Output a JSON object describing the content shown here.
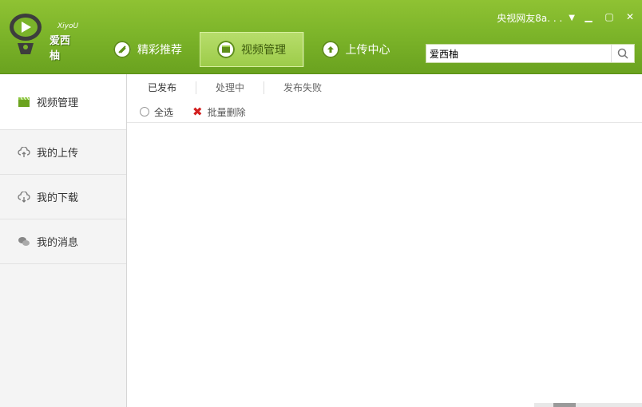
{
  "app": {
    "logo_text": "爱西柚",
    "logo_sub": "XiyoU"
  },
  "nav": {
    "tabs": [
      {
        "label": "精彩推荐",
        "icon": "recommend-icon"
      },
      {
        "label": "视频管理",
        "icon": "video-manage-icon",
        "active": true
      },
      {
        "label": "上传中心",
        "icon": "upload-center-icon"
      }
    ]
  },
  "user": {
    "name": "央视网友8a. . ."
  },
  "window_controls": [
    "chevron-down-icon",
    "minimize-icon",
    "maximize-icon",
    "close-icon"
  ],
  "search": {
    "value": "爱西柚"
  },
  "sidebar": {
    "items": [
      {
        "label": "视频管理",
        "icon": "video-clapper-icon",
        "active": true
      },
      {
        "label": "我的上传",
        "icon": "cloud-upload-icon"
      },
      {
        "label": "我的下载",
        "icon": "cloud-download-icon"
      },
      {
        "label": "我的消息",
        "icon": "chat-bubbles-icon"
      }
    ]
  },
  "content": {
    "sub_tabs": [
      {
        "label": "已发布",
        "active": true
      },
      {
        "label": "处理中"
      },
      {
        "label": "发布失败"
      }
    ],
    "toolbar": {
      "select_all": "全选",
      "batch_delete": "批量删除"
    }
  },
  "colors": {
    "header_green": "#7db52a",
    "active_tab": "#9dcc4a",
    "delete_red": "#d32020"
  }
}
